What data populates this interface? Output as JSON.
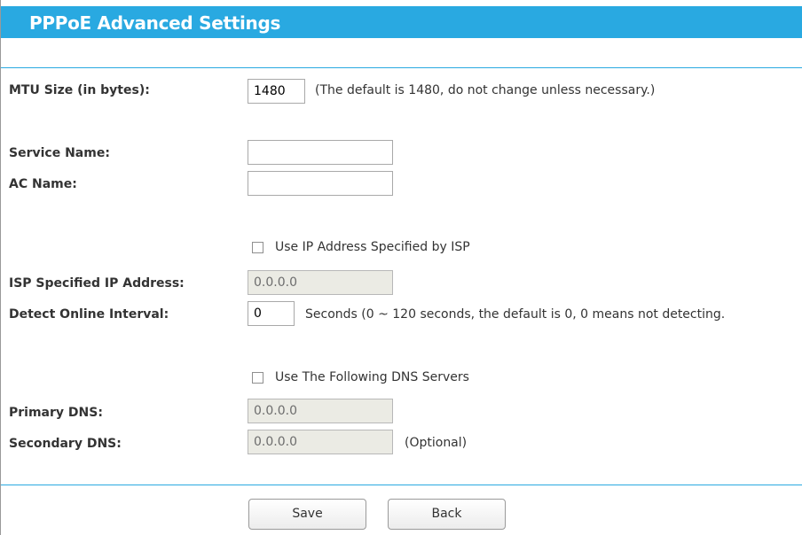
{
  "header": {
    "title": "PPPoE Advanced Settings"
  },
  "mtu": {
    "label": "MTU Size (in bytes):",
    "value": "1480",
    "hint": "(The default is 1480, do not change unless necessary.)"
  },
  "service_name": {
    "label": "Service Name:",
    "value": ""
  },
  "ac_name": {
    "label": "AC Name:",
    "value": ""
  },
  "use_isp_ip": {
    "label": "Use IP Address Specified by ISP",
    "checked": false
  },
  "isp_ip": {
    "label": "ISP Specified IP Address:",
    "value": "0.0.0.0"
  },
  "detect_interval": {
    "label": "Detect Online Interval:",
    "value": "0",
    "hint": "Seconds (0 ~ 120 seconds, the default is 0, 0 means not detecting."
  },
  "use_dns": {
    "label": "Use The Following DNS Servers",
    "checked": false
  },
  "primary_dns": {
    "label": "Primary DNS:",
    "value": "0.0.0.0"
  },
  "secondary_dns": {
    "label": "Secondary DNS:",
    "value": "0.0.0.0",
    "hint": "(Optional)"
  },
  "buttons": {
    "save": "Save",
    "back": "Back"
  },
  "colors": {
    "accent": "#29a9e1",
    "disabled_field": "#ebebe4"
  }
}
